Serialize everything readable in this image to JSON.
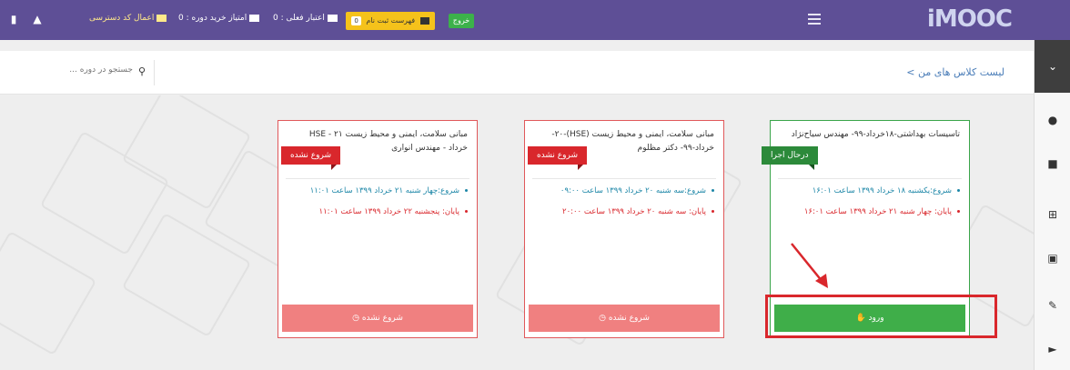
{
  "topbar": {
    "logo": "iMOOC",
    "access_code_link": "اعمال کد دسترسی",
    "course_points": "امتیاز خرید دوره : 0",
    "current_credit": "اعتبار فعلی : 0",
    "cart_label": "فهرست ثبت نام",
    "cart_count": "0",
    "exit_label": "خروج"
  },
  "breadcrumb": "لیست کلاس های من >",
  "search": {
    "placeholder": "جستجو در دوره ..."
  },
  "cards": [
    {
      "title": "تاسیسات بهداشتی-۱۸خرداد-۹۹- مهندس سیاح‌نژاد",
      "status": "درحال اجرا",
      "start": "شروع:یکشنبه ۱۸ خرداد ۱۳۹۹ ساعت ۱۶:۰۱",
      "end": "پایان: چهار شنبه ۲۱ خرداد ۱۳۹۹ ساعت ۱۶:۰۱",
      "button": "ورود"
    },
    {
      "title": "مبانی سلامت، ایمنی و محیط زیست (HSE)-۲۰-خرداد-۹۹- دکتر مظلوم",
      "status": "شروع نشده",
      "start": "شروع:سه شنبه ۲۰ خرداد ۱۳۹۹ ساعت ۰۹:۰۰",
      "end": "پایان: سه شنبه ۲۰ خرداد ۱۳۹۹ ساعت ۲۰:۰۰",
      "button": "شروع نشده"
    },
    {
      "title": "مبانی سلامت، ایمنی و محیط زیست ۲۱ - HSE خرداد - مهندس انواری",
      "status": "شروع نشده",
      "start": "شروع:چهار شنبه ۲۱ خرداد ۱۳۹۹ ساعت ۱۱:۰۱",
      "end": "پایان: پنجشنبه ۲۲ خرداد ۱۳۹۹ ساعت ۱۱:۰۱",
      "button": "شروع نشده"
    }
  ],
  "colors": {
    "topbar": "#5e4f96",
    "accent_green": "#3fae49",
    "accent_red": "#d9272c",
    "disabled_button": "#f08080",
    "link_blue": "#4a7db8"
  }
}
